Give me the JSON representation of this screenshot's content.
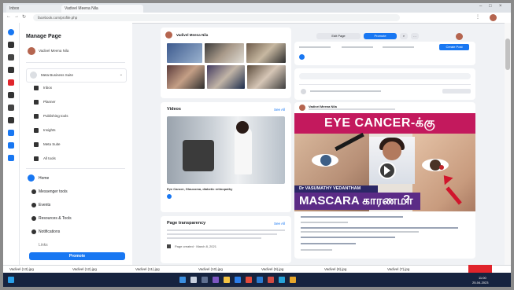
{
  "browser": {
    "tabs": [
      {
        "label": "Inbox"
      },
      {
        "label": "Vadivel Meena Nila"
      }
    ],
    "url": "facebook.com/profile.php"
  },
  "left_panel": {
    "title": "Manage Page",
    "profile_name": "Vadivel Meena Nila",
    "switch_label": "Meta Business Suite",
    "sub_items": [
      "Inbox",
      "Planner",
      "Publishing tools",
      "Insights",
      "Meta Suite",
      "All tools"
    ],
    "nav_items": [
      "Home",
      "Messenger tools",
      "Events",
      "Resources & Tools",
      "Notifications",
      "Links"
    ],
    "promote_label": "Promote"
  },
  "middle": {
    "page_name": "Vadivel Meena Nila",
    "videos_title": "Videos",
    "see_all": "See All",
    "video_caption": "Eye Cancer, Glaucoma, diabetic retinopathy",
    "transparency_title": "Page transparency",
    "transparency_see_all": "See All",
    "created_label": "Page created · March 8, 2021"
  },
  "right": {
    "edit_button": "Edit Page",
    "promote_button": "Promote",
    "create_post": "Create Post",
    "post_author": "Vadivel Meena Nila",
    "poster_title": "EYE CANCER-க்கு",
    "poster_name": "Dr VASUMATHY VEDANTHAM",
    "poster_mascara": "MASCARA காரணமா",
    "poster_qmark": "?"
  },
  "downloads": [
    "Vadivel (13).jpg",
    "Vadivel (12).jpg",
    "Vadivel (11).jpg",
    "Vadivel (10).jpg",
    "Vadivel (9).jpg",
    "Vadivel (8).jpg",
    "Vadivel (7).jpg"
  ],
  "taskbar": {
    "time": "11:00",
    "date": "25-04-2023"
  },
  "colors": {
    "accent": "#1877f2",
    "poster_pink": "#c3195d",
    "poster_purple": "#5b2b86",
    "taskbar": "#16233f"
  }
}
